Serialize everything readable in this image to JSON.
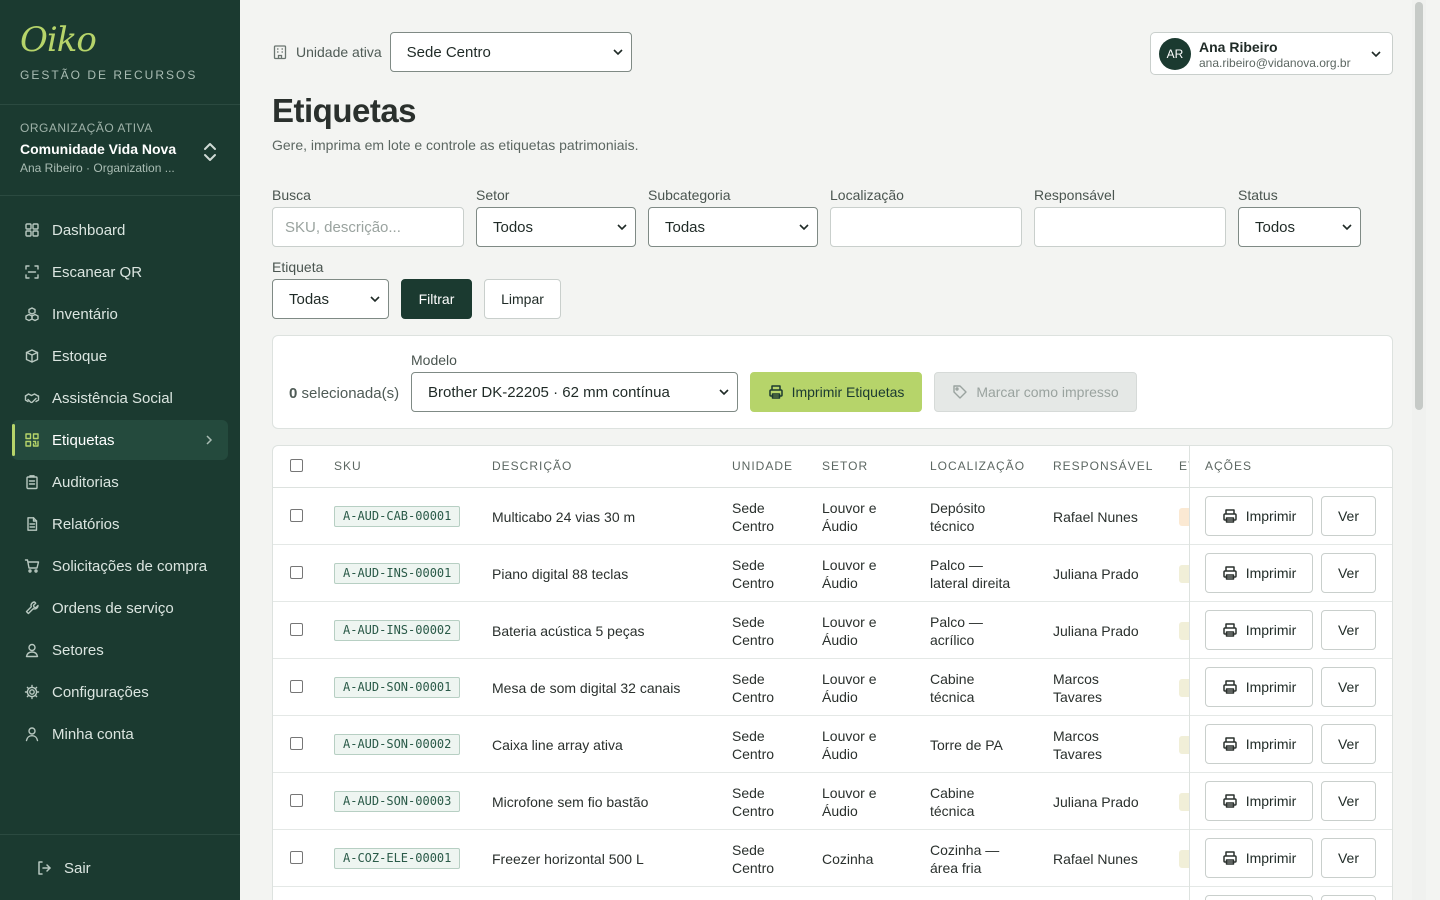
{
  "brand": {
    "logo": "Oiko",
    "subtitle": "GESTÃO DE RECURSOS"
  },
  "organization": {
    "label": "ORGANIZAÇÃO ATIVA",
    "name": "Comunidade Vida Nova",
    "user": "Ana Ribeiro · Organization ..."
  },
  "nav": [
    {
      "label": "Dashboard",
      "icon": "dashboard-icon"
    },
    {
      "label": "Escanear QR",
      "icon": "scan-icon"
    },
    {
      "label": "Inventário",
      "icon": "boxes-icon"
    },
    {
      "label": "Estoque",
      "icon": "package-icon"
    },
    {
      "label": "Assistência Social",
      "icon": "handshake-icon"
    },
    {
      "label": "Etiquetas",
      "icon": "qr-icon",
      "active": true
    },
    {
      "label": "Auditorias",
      "icon": "clipboard-icon"
    },
    {
      "label": "Relatórios",
      "icon": "report-icon"
    },
    {
      "label": "Solicitações de compra",
      "icon": "cart-icon"
    },
    {
      "label": "Ordens de serviço",
      "icon": "wrench-icon"
    },
    {
      "label": "Setores",
      "icon": "users-icon"
    },
    {
      "label": "Configurações",
      "icon": "gear-icon"
    },
    {
      "label": "Minha conta",
      "icon": "user-icon"
    }
  ],
  "logout_label": "Sair",
  "topbar": {
    "unit_label": "Unidade ativa",
    "unit_value": "Sede Centro",
    "user_initials": "AR",
    "user_name": "Ana Ribeiro",
    "user_email": "ana.ribeiro@vidanova.org.br"
  },
  "page": {
    "title": "Etiquetas",
    "subtitle": "Gere, imprima em lote e controle as etiquetas patrimoniais."
  },
  "filters": {
    "busca_label": "Busca",
    "busca_placeholder": "SKU, descrição...",
    "setor_label": "Setor",
    "setor_value": "Todos",
    "subcategoria_label": "Subcategoria",
    "subcategoria_value": "Todas",
    "localizacao_label": "Localização",
    "responsavel_label": "Responsável",
    "status_label": "Status",
    "status_value": "Todos",
    "etiqueta_label": "Etiqueta",
    "etiqueta_value": "Todas",
    "filtrar": "Filtrar",
    "limpar": "Limpar"
  },
  "batch": {
    "count": "0",
    "count_suffix": "selecionada(s)",
    "model_label": "Modelo",
    "model_value": "Brother DK-22205 · 62 mm contínua",
    "print_label": "Imprimir Etiquetas",
    "mark_label": "Marcar como impresso"
  },
  "table": {
    "headers": {
      "sku": "SKU",
      "descricao": "DESCRIÇÃO",
      "unidade": "UNIDADE",
      "setor": "SETOR",
      "localizacao": "LOCALIZAÇÃO",
      "responsavel": "RESPONSÁVEL",
      "etiqueta_partial": "ET",
      "acoes": "AÇÕES"
    },
    "print_btn": "Imprimir",
    "view_btn": "Ver",
    "rows": [
      {
        "sku": "A-AUD-CAB-00001",
        "descricao": "Multicabo 24 vias 30 m",
        "unidade_1": "Sede",
        "unidade_2": "Centro",
        "setor_1": "Louvor e",
        "setor_2": "Áudio",
        "loc_1": "Depósito",
        "loc_2": "técnico",
        "resp_1": "Rafael Nunes",
        "resp_2": "",
        "badge": "orange"
      },
      {
        "sku": "A-AUD-INS-00001",
        "descricao": "Piano digital 88 teclas",
        "unidade_1": "Sede",
        "unidade_2": "Centro",
        "setor_1": "Louvor e",
        "setor_2": "Áudio",
        "loc_1": "Palco —",
        "loc_2": "lateral direita",
        "resp_1": "Juliana Prado",
        "resp_2": "",
        "badge": "yellow"
      },
      {
        "sku": "A-AUD-INS-00002",
        "descricao": "Bateria acústica 5 peças",
        "unidade_1": "Sede",
        "unidade_2": "Centro",
        "setor_1": "Louvor e",
        "setor_2": "Áudio",
        "loc_1": "Palco —",
        "loc_2": "acrílico",
        "resp_1": "Juliana Prado",
        "resp_2": "",
        "badge": "yellow"
      },
      {
        "sku": "A-AUD-SON-00001",
        "descricao": "Mesa de som digital 32 canais",
        "unidade_1": "Sede",
        "unidade_2": "Centro",
        "setor_1": "Louvor e",
        "setor_2": "Áudio",
        "loc_1": "Cabine",
        "loc_2": "técnica",
        "resp_1": "Marcos",
        "resp_2": "Tavares",
        "badge": "yellow"
      },
      {
        "sku": "A-AUD-SON-00002",
        "descricao": "Caixa line array ativa",
        "unidade_1": "Sede",
        "unidade_2": "Centro",
        "setor_1": "Louvor e",
        "setor_2": "Áudio",
        "loc_1": "Torre de PA",
        "loc_2": "",
        "resp_1": "Marcos",
        "resp_2": "Tavares",
        "badge": "yellow"
      },
      {
        "sku": "A-AUD-SON-00003",
        "descricao": "Microfone sem fio bastão",
        "unidade_1": "Sede",
        "unidade_2": "Centro",
        "setor_1": "Louvor e",
        "setor_2": "Áudio",
        "loc_1": "Cabine",
        "loc_2": "técnica",
        "resp_1": "Juliana Prado",
        "resp_2": "",
        "badge": "yellow"
      },
      {
        "sku": "A-COZ-ELE-00001",
        "descricao": "Freezer horizontal 500 L",
        "unidade_1": "Sede",
        "unidade_2": "Centro",
        "setor_1": "Cozinha",
        "setor_2": "",
        "loc_1": "Cozinha —",
        "loc_2": "área fria",
        "resp_1": "Rafael Nunes",
        "resp_2": "",
        "badge": "yellow"
      }
    ]
  },
  "colors": {
    "sidebar_bg": "#1b3a30",
    "accent_lime": "#b6d46a",
    "page_bg": "#f3f4f2"
  }
}
